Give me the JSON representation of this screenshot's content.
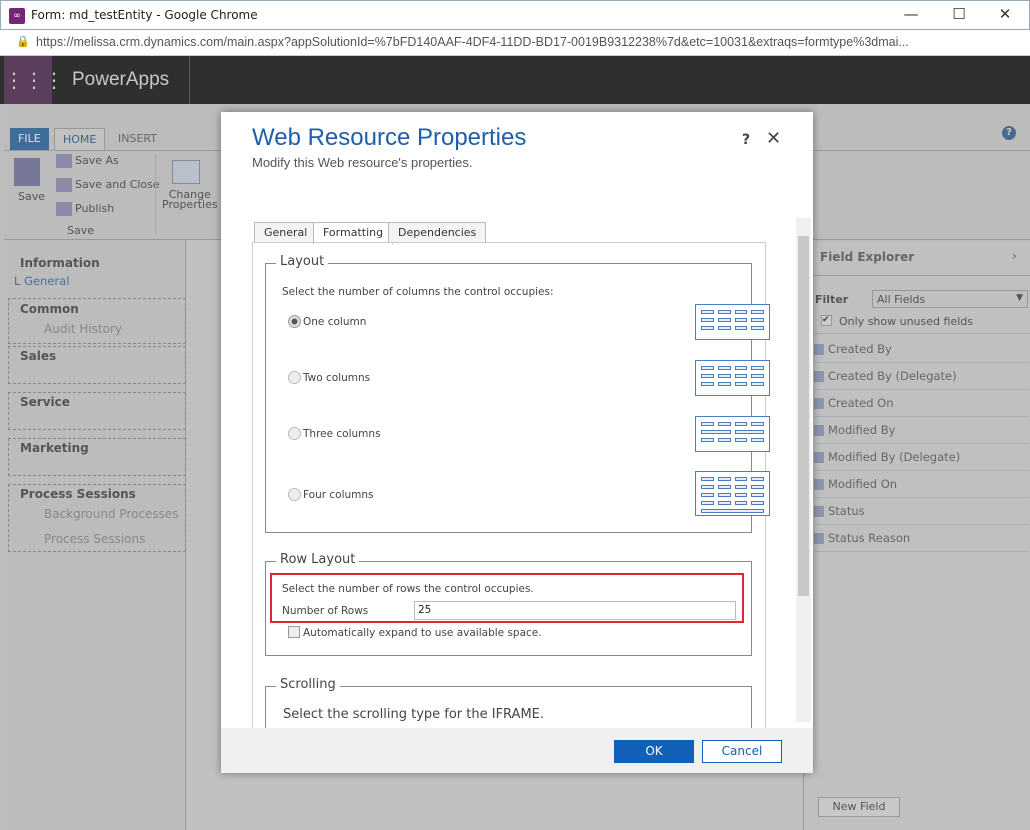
{
  "browser": {
    "title": "Form: md_testEntity - Google Chrome",
    "url": "https://melissa.crm.dynamics.com/main.aspx?appSolutionId=%7bFD140AAF-4DF4-11DD-BD17-0019B9312238%7d&etc=10031&extraqs=formtype%3dmai...",
    "minimize": "—",
    "maximize": "☐",
    "close": "✕"
  },
  "app": {
    "title": "PowerApps"
  },
  "ribbon": {
    "tabs": [
      "FILE",
      "HOME",
      "INSERT"
    ],
    "save": "Save",
    "save_as": "Save As",
    "save_close": "Save and Close",
    "publish": "Publish",
    "group": "Save",
    "change_properties": [
      "Change",
      "Properties"
    ],
    "help": "?"
  },
  "nav": {
    "sections": [
      "Information",
      "Common",
      "Sales",
      "Service",
      "Marketing",
      "Process Sessions"
    ],
    "general": "General",
    "audit": "Audit History",
    "bg": "Background Processes",
    "ps": "Process Sessions"
  },
  "field_explorer": {
    "title": "Field Explorer",
    "filter_label": "Filter",
    "filter_value": "All Fields",
    "unused": "Only show unused fields",
    "fields": [
      "Created By",
      "Created By (Delegate)",
      "Created On",
      "Modified By",
      "Modified By (Delegate)",
      "Modified On",
      "Status",
      "Status Reason"
    ],
    "new_field": "New Field"
  },
  "dialog": {
    "title": "Web Resource Properties",
    "subtitle": "Modify this Web resource's properties.",
    "help": "?",
    "close": "✕",
    "tabs": [
      "General",
      "Formatting",
      "Dependencies"
    ],
    "active_tab": "Formatting",
    "layout": {
      "legend": "Layout",
      "instruction": "Select the number of columns the control occupies:",
      "options": [
        "One column",
        "Two columns",
        "Three columns",
        "Four columns"
      ],
      "selected": "One column"
    },
    "row_layout": {
      "legend": "Row Layout",
      "instruction": "Select the number of rows the control occupies.",
      "rows_label": "Number of Rows",
      "rows_value": "25",
      "auto_expand": "Automatically expand to use available space.",
      "auto_expand_checked": false
    },
    "scrolling": {
      "legend": "Scrolling",
      "instruction": "Select the scrolling type for the IFRAME."
    },
    "ok": "OK",
    "cancel": "Cancel"
  },
  "colors": {
    "accent": "#1160b7",
    "highlight": "#e0262e",
    "title": "#1f5fa8"
  }
}
